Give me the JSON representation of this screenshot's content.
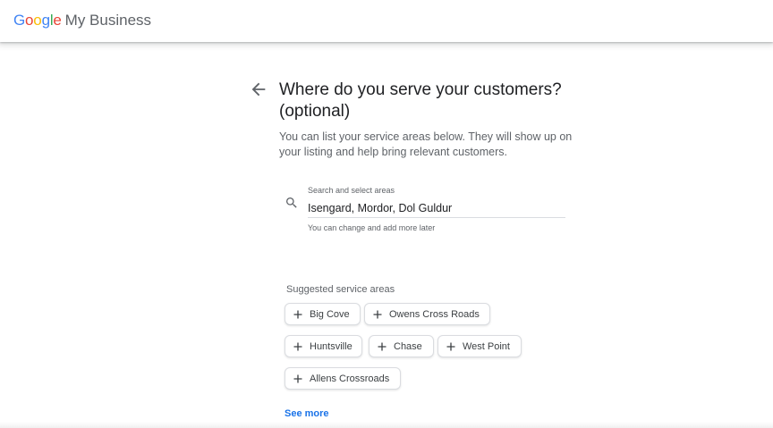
{
  "header": {
    "logo_google": [
      "G",
      "o",
      "o",
      "g",
      "l",
      "e"
    ],
    "logo_colors": [
      "#4285F4",
      "#EA4335",
      "#FBBC05",
      "#4285F4",
      "#34A853",
      "#EA4335"
    ],
    "product_name": "My Business"
  },
  "page": {
    "title": "Where do you serve your customers? (optional)",
    "subtitle": "You can list your service areas below. They will show up on your listing and help bring relevant customers."
  },
  "search": {
    "label": "Search and select areas",
    "value": "Isengard, Mordor, Dol Guldur",
    "helper": "You can change and add more later"
  },
  "suggestions": {
    "label": "Suggested service areas",
    "chips": [
      "Big Cove",
      "Owens Cross Roads",
      "Huntsville",
      "Chase",
      "West Point",
      "Allens Crossroads"
    ],
    "see_more": "See more"
  },
  "colors": {
    "accent": "#1a73e8",
    "text_primary": "#202124",
    "text_secondary": "#5f6368"
  },
  "icons": {
    "back": "arrow-left-icon",
    "search": "search-icon",
    "chip": "plus-icon"
  }
}
